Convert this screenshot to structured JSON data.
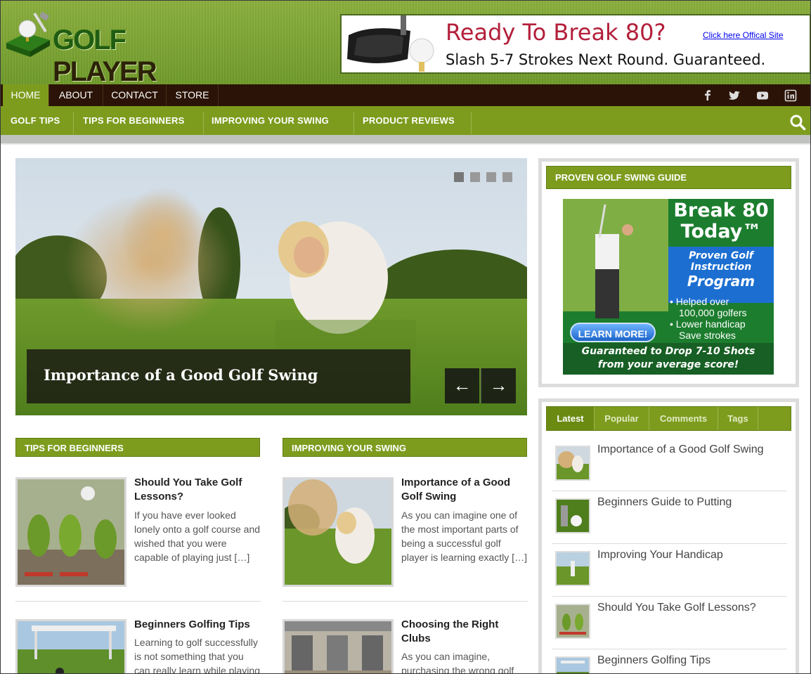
{
  "site": {
    "logo_word1": "GOLF",
    "logo_word2": "PLAYER"
  },
  "ad_banner": {
    "headline": "Ready To Break 80?",
    "subline": "Slash 5-7 Strokes Next Round.  Guaranteed.",
    "link": "Click here Offical Site"
  },
  "top_nav": {
    "items": [
      "HOME",
      "ABOUT",
      "CONTACT",
      "STORE"
    ],
    "active": "HOME"
  },
  "social_icons": [
    "facebook-icon",
    "twitter-icon",
    "youtube-icon",
    "linkedin-icon"
  ],
  "category_nav": {
    "items": [
      "GOLF TIPS",
      "TIPS FOR BEGINNERS",
      "IMPROVING YOUR SWING",
      "PRODUCT REVIEWS"
    ]
  },
  "slider": {
    "caption": "Importance of a Good Golf Swing",
    "prev": "←",
    "next": "→",
    "slide_count": 4,
    "active_slide": 1
  },
  "sections": [
    {
      "title": "TIPS FOR BEGINNERS",
      "posts": [
        {
          "title": "Should You Take Golf Lessons?",
          "excerpt": "If you have ever looked lonely onto a golf course and wished that you were capable of playing just […]"
        },
        {
          "title": "Beginners Golfing Tips",
          "excerpt": "Learning to golf successfully is not something that you can really learn while playing a"
        }
      ]
    },
    {
      "title": "IMPROVING YOUR SWING",
      "posts": [
        {
          "title": "Importance of a Good Golf Swing",
          "excerpt": "As you can imagine one of the most important parts of being a successful golf player is learning exactly […]"
        },
        {
          "title": "Choosing the Right Clubs",
          "excerpt": "As you can imagine, purchasing the wrong golf"
        }
      ]
    }
  ],
  "sidebar": {
    "guide_widget": {
      "title": "PROVEN GOLF SWING GUIDE",
      "ad": {
        "line1": "Break 80",
        "line2": "Today™",
        "box1": "Proven Golf",
        "box2": "Instruction",
        "box3": "Program",
        "bullet1": "• Helped over",
        "bullet1b": "100,000 golfers",
        "bullet2": "• Lower handicap",
        "bullet3": "Save strokes",
        "button": "LEARN MORE!",
        "footer1": "Guaranteed to Drop 7-10 Shots",
        "footer2": "from your average score!"
      }
    },
    "tabs": {
      "items": [
        "Latest",
        "Popular",
        "Comments",
        "Tags"
      ],
      "active": "Latest"
    },
    "latest_posts": [
      "Importance of a Good Golf Swing",
      "Beginners Guide to Putting",
      "Improving Your Handicap",
      "Should You Take Golf Lessons?",
      "Beginners Golfing Tips"
    ]
  },
  "colors": {
    "brand_green": "#7d9c1e",
    "nav_brown": "#2b1407",
    "ad_red": "#b3203b"
  }
}
